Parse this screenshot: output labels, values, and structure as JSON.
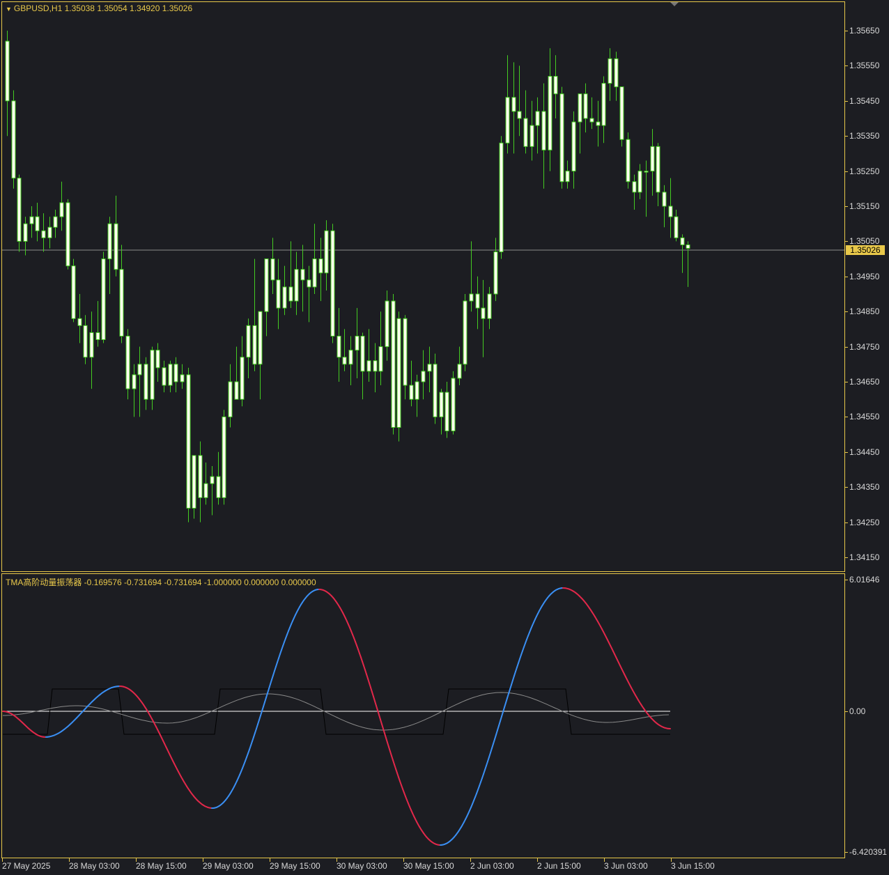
{
  "symbol_header": "GBPUSD,H1  1.35038 1.35054 1.34920 1.35026",
  "oscillator_header": "TMA高阶动量振荡器  -0.169576 -0.731694 -0.731694 -1.000000 0.000000 0.000000",
  "current_price": "1.35026",
  "price_scale": [
    "1.35650",
    "1.35550",
    "1.35450",
    "1.35350",
    "1.35250",
    "1.35150",
    "1.35050",
    "1.34950",
    "1.34850",
    "1.34750",
    "1.34650",
    "1.34550",
    "1.34450",
    "1.34350",
    "1.34250",
    "1.34150"
  ],
  "oscillator_scale": {
    "max": "6.01646",
    "zero": "0.00",
    "min": "-6.420391"
  },
  "time_labels": [
    "27 May 2025",
    "28 May 03:00",
    "28 May 15:00",
    "29 May 03:00",
    "29 May 15:00",
    "30 May 03:00",
    "30 May 15:00",
    "2 Jun 03:00",
    "2 Jun 15:00",
    "3 Jun 03:00",
    "3 Jun 15:00"
  ],
  "colors": {
    "background": "#1c1d22",
    "frame": "#e8c84a",
    "candle_wick": "#44cc22",
    "candle_body": "#ffffee",
    "osc_up": "#3a8ef2",
    "osc_down": "#e0284a",
    "signal": "#8a8a8a",
    "square": "#000000",
    "zero_line": "#ffffff"
  },
  "chart_data": [
    {
      "type": "candlestick",
      "title": "GBPUSD,H1",
      "ylim": [
        1.341,
        1.357
      ],
      "ohlc": [
        [
          1.3562,
          1.3565,
          1.3535,
          1.3545
        ],
        [
          1.3545,
          1.3548,
          1.352,
          1.3523
        ],
        [
          1.3523,
          1.3524,
          1.3502,
          1.3505
        ],
        [
          1.3505,
          1.3512,
          1.3501,
          1.351
        ],
        [
          1.351,
          1.3515,
          1.3506,
          1.3512
        ],
        [
          1.3512,
          1.3516,
          1.3505,
          1.3508
        ],
        [
          1.3508,
          1.3513,
          1.3502,
          1.3506
        ],
        [
          1.3506,
          1.3512,
          1.3503,
          1.3509
        ],
        [
          1.3509,
          1.3514,
          1.3506,
          1.3512
        ],
        [
          1.3512,
          1.3522,
          1.3508,
          1.3516
        ],
        [
          1.3516,
          1.3517,
          1.3497,
          1.3498
        ],
        [
          1.3498,
          1.35,
          1.3482,
          1.3483
        ],
        [
          1.3483,
          1.349,
          1.3476,
          1.3481
        ],
        [
          1.3481,
          1.3484,
          1.347,
          1.3472
        ],
        [
          1.3472,
          1.3485,
          1.3463,
          1.3479
        ],
        [
          1.3479,
          1.3488,
          1.3475,
          1.3477
        ],
        [
          1.3477,
          1.3502,
          1.3476,
          1.35
        ],
        [
          1.35,
          1.3512,
          1.349,
          1.351
        ],
        [
          1.351,
          1.3518,
          1.3495,
          1.3497
        ],
        [
          1.3497,
          1.3504,
          1.3476,
          1.3478
        ],
        [
          1.3478,
          1.348,
          1.346,
          1.3463
        ],
        [
          1.3463,
          1.347,
          1.3455,
          1.3467
        ],
        [
          1.3467,
          1.3475,
          1.3455,
          1.347
        ],
        [
          1.347,
          1.3472,
          1.3457,
          1.346
        ],
        [
          1.346,
          1.3475,
          1.3457,
          1.3474
        ],
        [
          1.3474,
          1.3476,
          1.3465,
          1.3469
        ],
        [
          1.3469,
          1.3471,
          1.3462,
          1.3464
        ],
        [
          1.3464,
          1.3471,
          1.3462,
          1.347
        ],
        [
          1.347,
          1.3472,
          1.3462,
          1.3465
        ],
        [
          1.3465,
          1.347,
          1.3463,
          1.3467
        ],
        [
          1.3467,
          1.3469,
          1.3425,
          1.3429
        ],
        [
          1.3429,
          1.3441,
          1.3426,
          1.3444
        ],
        [
          1.3444,
          1.3448,
          1.3425,
          1.3432
        ],
        [
          1.3432,
          1.3442,
          1.343,
          1.3436
        ],
        [
          1.3436,
          1.3441,
          1.3427,
          1.3438
        ],
        [
          1.3438,
          1.3445,
          1.343,
          1.3432
        ],
        [
          1.3432,
          1.3457,
          1.343,
          1.3455
        ],
        [
          1.3455,
          1.347,
          1.3452,
          1.3465
        ],
        [
          1.3465,
          1.3475,
          1.346,
          1.346
        ],
        [
          1.346,
          1.3478,
          1.3458,
          1.3472
        ],
        [
          1.3472,
          1.3483,
          1.3466,
          1.3481
        ],
        [
          1.3481,
          1.35,
          1.3468,
          1.347
        ],
        [
          1.347,
          1.3482,
          1.346,
          1.3485
        ],
        [
          1.3485,
          1.3495,
          1.3478,
          1.35
        ],
        [
          1.35,
          1.3506,
          1.349,
          1.3494
        ],
        [
          1.3494,
          1.35,
          1.348,
          1.3486
        ],
        [
          1.3486,
          1.3498,
          1.3484,
          1.3492
        ],
        [
          1.3492,
          1.3505,
          1.3486,
          1.3488
        ],
        [
          1.3488,
          1.3502,
          1.3484,
          1.3497
        ],
        [
          1.3497,
          1.3504,
          1.3485,
          1.3494
        ],
        [
          1.3494,
          1.3498,
          1.3482,
          1.3492
        ],
        [
          1.3492,
          1.351,
          1.349,
          1.35
        ],
        [
          1.35,
          1.3506,
          1.3488,
          1.3496
        ],
        [
          1.3496,
          1.3511,
          1.3491,
          1.3508
        ],
        [
          1.3508,
          1.351,
          1.3476,
          1.3478
        ],
        [
          1.3478,
          1.3486,
          1.3465,
          1.3472
        ],
        [
          1.3472,
          1.348,
          1.3468,
          1.347
        ],
        [
          1.347,
          1.3478,
          1.3464,
          1.3474
        ],
        [
          1.3474,
          1.3486,
          1.3466,
          1.3478
        ],
        [
          1.3478,
          1.3479,
          1.346,
          1.3468
        ],
        [
          1.3468,
          1.348,
          1.3465,
          1.3471
        ],
        [
          1.3471,
          1.3476,
          1.3462,
          1.3468
        ],
        [
          1.3468,
          1.3485,
          1.3464,
          1.3475
        ],
        [
          1.3475,
          1.3491,
          1.3471,
          1.3488
        ],
        [
          1.3488,
          1.349,
          1.345,
          1.3452
        ],
        [
          1.3452,
          1.3485,
          1.3448,
          1.3483
        ],
        [
          1.3483,
          1.3484,
          1.346,
          1.3464
        ],
        [
          1.3464,
          1.3471,
          1.3458,
          1.346
        ],
        [
          1.346,
          1.3467,
          1.3455,
          1.3465
        ],
        [
          1.3465,
          1.3474,
          1.346,
          1.3468
        ],
        [
          1.3468,
          1.3475,
          1.3462,
          1.347
        ],
        [
          1.347,
          1.3473,
          1.3453,
          1.3455
        ],
        [
          1.3455,
          1.3463,
          1.345,
          1.3462
        ],
        [
          1.3462,
          1.3465,
          1.3449,
          1.3451
        ],
        [
          1.3451,
          1.3468,
          1.345,
          1.3466
        ],
        [
          1.3466,
          1.3475,
          1.3464,
          1.347
        ],
        [
          1.347,
          1.349,
          1.3468,
          1.3488
        ],
        [
          1.3488,
          1.3505,
          1.3485,
          1.349
        ],
        [
          1.349,
          1.3495,
          1.348,
          1.3486
        ],
        [
          1.3486,
          1.3494,
          1.3472,
          1.3483
        ],
        [
          1.3483,
          1.3492,
          1.348,
          1.349
        ],
        [
          1.349,
          1.3506,
          1.3488,
          1.3502
        ],
        [
          1.3502,
          1.3535,
          1.35,
          1.3533
        ],
        [
          1.3533,
          1.3558,
          1.353,
          1.3546
        ],
        [
          1.3546,
          1.3556,
          1.353,
          1.3542
        ],
        [
          1.3542,
          1.3555,
          1.3535,
          1.354
        ],
        [
          1.354,
          1.3548,
          1.353,
          1.3532
        ],
        [
          1.3532,
          1.3545,
          1.3528,
          1.3538
        ],
        [
          1.3538,
          1.3546,
          1.353,
          1.3542
        ],
        [
          1.3542,
          1.355,
          1.352,
          1.3531
        ],
        [
          1.3531,
          1.356,
          1.3525,
          1.3552
        ],
        [
          1.3552,
          1.3558,
          1.354,
          1.3547
        ],
        [
          1.3547,
          1.3549,
          1.352,
          1.3522
        ],
        [
          1.3522,
          1.3528,
          1.352,
          1.3525
        ],
        [
          1.3525,
          1.3542,
          1.352,
          1.3539
        ],
        [
          1.3539,
          1.3546,
          1.353,
          1.3547
        ],
        [
          1.3547,
          1.355,
          1.3536,
          1.354
        ],
        [
          1.354,
          1.3546,
          1.3537,
          1.3539
        ],
        [
          1.3539,
          1.3545,
          1.3532,
          1.3538
        ],
        [
          1.3538,
          1.3552,
          1.3533,
          1.355
        ],
        [
          1.355,
          1.356,
          1.3545,
          1.3557
        ],
        [
          1.3557,
          1.3559,
          1.3545,
          1.3549
        ],
        [
          1.3549,
          1.3549,
          1.3532,
          1.3534
        ],
        [
          1.3534,
          1.3536,
          1.352,
          1.3522
        ],
        [
          1.3522,
          1.3524,
          1.3514,
          1.3519
        ],
        [
          1.3519,
          1.3527,
          1.3517,
          1.3525
        ],
        [
          1.3525,
          1.3528,
          1.3512,
          1.3525
        ],
        [
          1.3525,
          1.3537,
          1.3518,
          1.3532
        ],
        [
          1.3532,
          1.3533,
          1.3515,
          1.3519
        ],
        [
          1.3519,
          1.3521,
          1.3509,
          1.3515
        ],
        [
          1.3515,
          1.3523,
          1.3506,
          1.3512
        ],
        [
          1.3512,
          1.3514,
          1.3505,
          1.3506
        ],
        [
          1.3506,
          1.3507,
          1.3496,
          1.3504
        ],
        [
          1.3504,
          1.3505,
          1.3492,
          1.3503
        ]
      ]
    },
    {
      "type": "line",
      "title": "TMA高阶动量振荡器",
      "ylim": [
        -6.420391,
        6.01646
      ],
      "series": []
    }
  ]
}
